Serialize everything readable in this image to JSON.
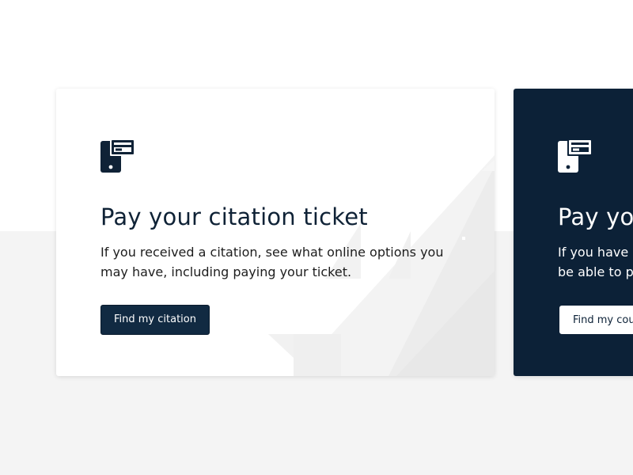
{
  "cards": [
    {
      "icon": "mobile-payment-icon",
      "title": "Pay your citation ticket",
      "description": "If you received a citation, see what online options you may have, including paying your ticket.",
      "button_label": "Find my citation"
    },
    {
      "icon": "mobile-payment-icon",
      "title": "Pay your court fees",
      "description": "If you have been assigned court fees, see what you may be able to pay online.",
      "button_label": "Find my court case"
    }
  ],
  "colors": {
    "page_background": "#ffffff",
    "band_background": "#f4f4f4",
    "card_dark": "#0c2137",
    "button_dark": "#112a42",
    "text_dark": "#0f2236"
  }
}
